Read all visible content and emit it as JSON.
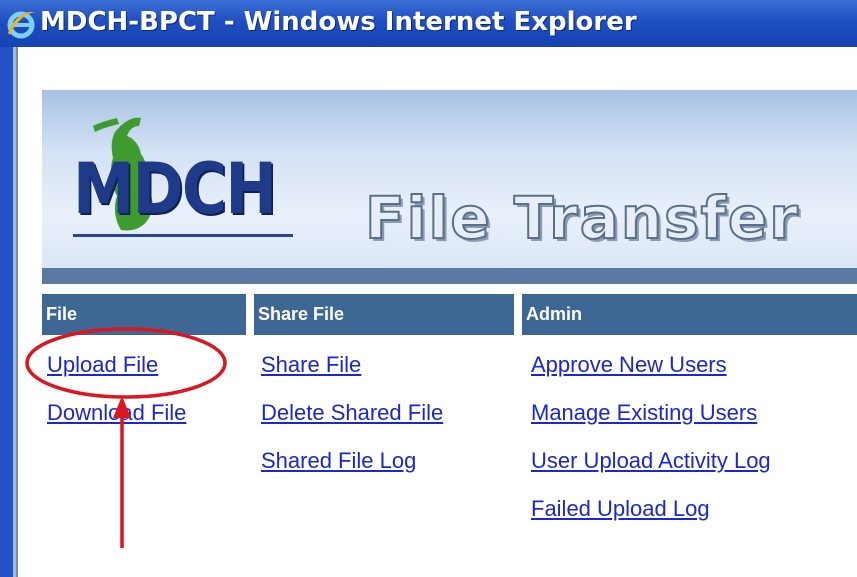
{
  "window": {
    "title": "MDCH-BPCT - Windows Internet Explorer",
    "icon": "internet-explorer-icon"
  },
  "banner": {
    "logo_text": "MDCH",
    "title": "File Transfer"
  },
  "menu": {
    "file": {
      "header": "File",
      "links": [
        "Upload File",
        "Download File"
      ]
    },
    "share": {
      "header": "Share File",
      "links": [
        "Share File",
        "Delete Shared File",
        "Shared File Log"
      ]
    },
    "admin": {
      "header": "Admin",
      "links": [
        "Approve New Users",
        "Manage Existing Users",
        "User Upload Activity Log",
        "Failed Upload Log"
      ]
    }
  },
  "annotation": {
    "highlight_color": "#e0141e",
    "target": "Upload File"
  },
  "colors": {
    "titlebar": "#1e4ec2",
    "header_bg": "#3e6796",
    "link": "#1a26d8",
    "banner_bar": "#5b7aa1"
  }
}
